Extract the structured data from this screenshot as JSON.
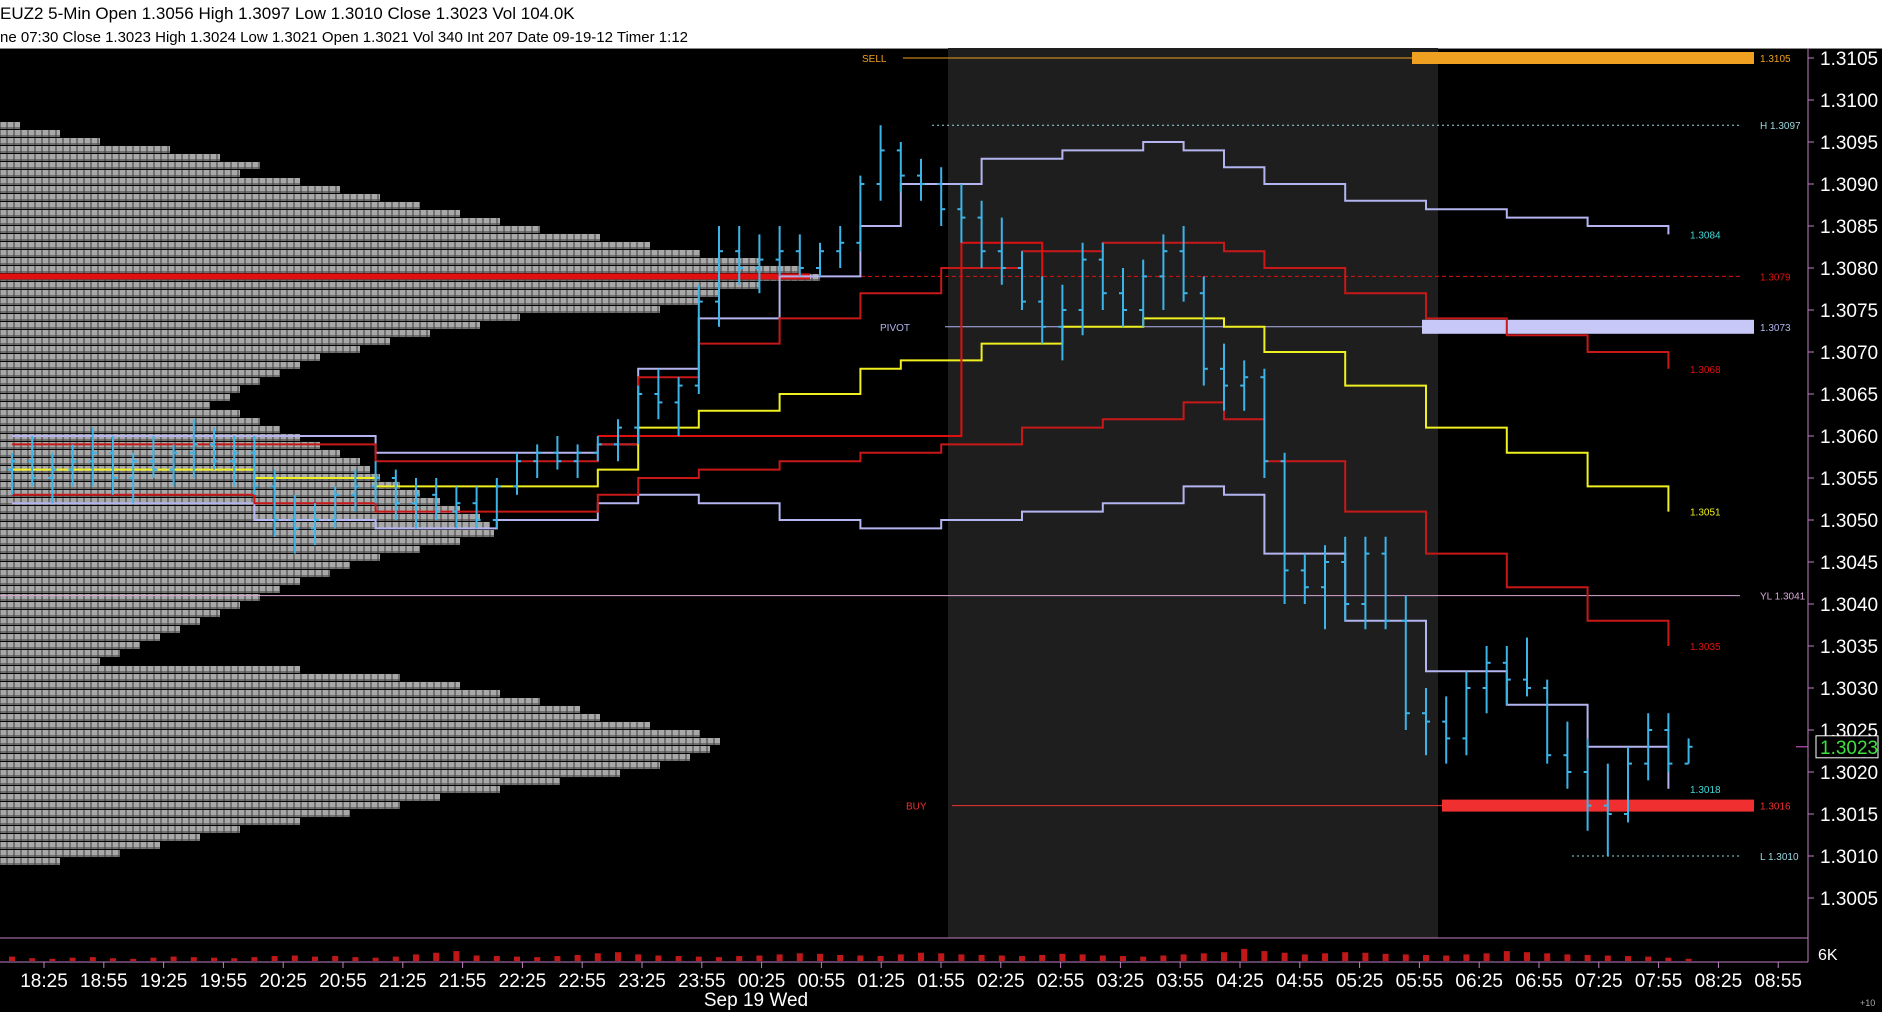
{
  "header": {
    "symbol_line": "EUZ2 5-Min Open 1.3056 High 1.3097 Low 1.3010 Close 1.3023 Vol 104.0K",
    "bar_line": "ne 07:30   Close 1.3023   High 1.3024   Low 1.3021   Open 1.3021   Vol 340   Int 207   Date 09-19-12   Timer 1:12"
  },
  "colors": {
    "background": "#000000",
    "session_shade": "#1e1e1e",
    "profile_gray": "#a8a8a8",
    "poc_red": "#e01010",
    "price_bars": "#3cb4e8",
    "vwap_yellow": "#f0f020",
    "band_red": "#c81818",
    "band_lavender": "#b4b4f0",
    "sell_orange": "#f0a020",
    "buy_red": "#f03030"
  },
  "chart_data": {
    "type": "line",
    "title": "EUZ2 5-Min",
    "ylim": [
      1.3002,
      1.3108
    ],
    "yticks": [
      "1.3105",
      "1.3100",
      "1.3095",
      "1.3090",
      "1.3085",
      "1.3080",
      "1.3075",
      "1.3070",
      "1.3065",
      "1.3060",
      "1.3055",
      "1.3050",
      "1.3045",
      "1.3040",
      "1.3035",
      "1.3030",
      "1.3025",
      "1.3020",
      "1.3015",
      "1.3010",
      "1.3005"
    ],
    "xticks": [
      "18:25",
      "18:55",
      "19:25",
      "19:55",
      "20:25",
      "20:55",
      "21:25",
      "21:55",
      "22:25",
      "22:55",
      "23:25",
      "23:55",
      "00:25",
      "00:55",
      "01:25",
      "01:55",
      "02:25",
      "02:55",
      "03:25",
      "03:55",
      "04:25",
      "04:55",
      "05:25",
      "05:55",
      "06:25",
      "06:55",
      "07:25",
      "07:55",
      "08:25",
      "08:55"
    ],
    "date_label": "Sep 19 Wed",
    "last_price_label": "1.3023",
    "volume_scale_label": "6K",
    "corner_label": "+10",
    "levels": [
      {
        "tag": "SELL",
        "value": 1.3105,
        "label": "1.3105",
        "color": "#f0a020"
      },
      {
        "tag": "H",
        "value": 1.3097,
        "label": "H 1.3097",
        "color": "#9ad8e0"
      },
      {
        "tag": "R",
        "value": 1.3079,
        "label": "1.3079",
        "color": "#e01010"
      },
      {
        "tag": "PIVOT",
        "value": 1.3073,
        "label": "1.3073",
        "color": "#b4b4f0"
      },
      {
        "tag": "YL",
        "value": 1.3041,
        "label": "YL 1.3041",
        "color": "#d8a8d8"
      },
      {
        "tag": "BUY",
        "value": 1.3016,
        "label": "1.3016",
        "color": "#f03030"
      },
      {
        "tag": "L",
        "value": 1.301,
        "label": "L 1.3010",
        "color": "#9ad8e0"
      }
    ],
    "band_labels": [
      {
        "value": 1.3084,
        "label": "1.3084",
        "color": "#40d8d8"
      },
      {
        "value": 1.3068,
        "label": "1.3068",
        "color": "#e01010"
      },
      {
        "value": 1.3051,
        "label": "1.3051",
        "color": "#f0f020"
      },
      {
        "value": 1.3035,
        "label": "1.3035",
        "color": "#e01010"
      },
      {
        "value": 1.3018,
        "label": "1.3018",
        "color": "#40d8d8"
      }
    ],
    "price_bars_series": [
      [
        0,
        1.3056,
        1.3058,
        1.3053,
        1.3057
      ],
      [
        1,
        1.3057,
        1.306,
        1.3054,
        1.3055
      ],
      [
        2,
        1.3055,
        1.3058,
        1.3052,
        1.3056
      ],
      [
        3,
        1.3056,
        1.3059,
        1.3054,
        1.3057
      ],
      [
        4,
        1.3057,
        1.3061,
        1.3054,
        1.3058
      ],
      [
        5,
        1.3058,
        1.306,
        1.3053,
        1.3055
      ],
      [
        6,
        1.3055,
        1.3058,
        1.3052,
        1.3057
      ],
      [
        7,
        1.3057,
        1.306,
        1.3055,
        1.3056
      ],
      [
        8,
        1.3056,
        1.3059,
        1.3054,
        1.3058
      ],
      [
        9,
        1.3058,
        1.3062,
        1.3055,
        1.3059
      ],
      [
        10,
        1.3059,
        1.3061,
        1.3056,
        1.3057
      ],
      [
        11,
        1.3057,
        1.306,
        1.3054,
        1.3058
      ],
      [
        12,
        1.3058,
        1.306,
        1.3053,
        1.3054
      ],
      [
        13,
        1.3054,
        1.3056,
        1.3048,
        1.305
      ],
      [
        14,
        1.305,
        1.3053,
        1.3046,
        1.3049
      ],
      [
        15,
        1.3049,
        1.3052,
        1.3047,
        1.305
      ],
      [
        16,
        1.305,
        1.3054,
        1.3049,
        1.3053
      ],
      [
        17,
        1.3053,
        1.3056,
        1.3051,
        1.3054
      ],
      [
        18,
        1.3054,
        1.3057,
        1.3052,
        1.3055
      ],
      [
        19,
        1.3055,
        1.3056,
        1.305,
        1.3052
      ],
      [
        20,
        1.3052,
        1.3055,
        1.3049,
        1.3053
      ],
      [
        21,
        1.3053,
        1.3055,
        1.305,
        1.3051
      ],
      [
        22,
        1.3051,
        1.3054,
        1.3049,
        1.3052
      ],
      [
        23,
        1.3052,
        1.3054,
        1.3049,
        1.305
      ],
      [
        24,
        1.305,
        1.3055,
        1.3049,
        1.3054
      ],
      [
        25,
        1.3054,
        1.3058,
        1.3053,
        1.3057
      ],
      [
        26,
        1.3057,
        1.3059,
        1.3055,
        1.3058
      ],
      [
        27,
        1.3058,
        1.306,
        1.3056,
        1.3057
      ],
      [
        28,
        1.3057,
        1.3059,
        1.3055,
        1.3058
      ],
      [
        29,
        1.3058,
        1.306,
        1.3057,
        1.3059
      ],
      [
        30,
        1.3059,
        1.3062,
        1.3057,
        1.3061
      ],
      [
        31,
        1.3061,
        1.3066,
        1.3059,
        1.3065
      ],
      [
        32,
        1.3065,
        1.3068,
        1.3062,
        1.3064
      ],
      [
        33,
        1.3064,
        1.3067,
        1.306,
        1.3066
      ],
      [
        34,
        1.3066,
        1.3078,
        1.3065,
        1.3076
      ],
      [
        35,
        1.3076,
        1.3085,
        1.3073,
        1.3082
      ],
      [
        36,
        1.3082,
        1.3085,
        1.3078,
        1.308
      ],
      [
        37,
        1.308,
        1.3084,
        1.3077,
        1.3081
      ],
      [
        38,
        1.3081,
        1.3085,
        1.3079,
        1.3082
      ],
      [
        39,
        1.3082,
        1.3084,
        1.3079,
        1.308
      ],
      [
        40,
        1.308,
        1.3083,
        1.3079,
        1.3082
      ],
      [
        41,
        1.3082,
        1.3085,
        1.308,
        1.3083
      ],
      [
        42,
        1.3083,
        1.3091,
        1.3082,
        1.309
      ],
      [
        43,
        1.309,
        1.3097,
        1.3088,
        1.3094
      ],
      [
        44,
        1.3094,
        1.3095,
        1.3089,
        1.3091
      ],
      [
        45,
        1.3091,
        1.3093,
        1.3088,
        1.309
      ],
      [
        46,
        1.309,
        1.3092,
        1.3085,
        1.3087
      ],
      [
        47,
        1.3087,
        1.309,
        1.3083,
        1.3086
      ],
      [
        48,
        1.3086,
        1.3088,
        1.308,
        1.3082
      ],
      [
        49,
        1.3082,
        1.3086,
        1.3078,
        1.308
      ],
      [
        50,
        1.308,
        1.3082,
        1.3075,
        1.3076
      ],
      [
        51,
        1.3076,
        1.3079,
        1.3071,
        1.3073
      ],
      [
        52,
        1.3073,
        1.3078,
        1.3069,
        1.3075
      ],
      [
        53,
        1.3075,
        1.3083,
        1.3072,
        1.3081
      ],
      [
        54,
        1.3081,
        1.3083,
        1.3075,
        1.3077
      ],
      [
        55,
        1.3077,
        1.308,
        1.3073,
        1.3075
      ],
      [
        56,
        1.3075,
        1.3081,
        1.3073,
        1.3079
      ],
      [
        57,
        1.3079,
        1.3084,
        1.3075,
        1.3082
      ],
      [
        58,
        1.3082,
        1.3085,
        1.3076,
        1.3077
      ],
      [
        59,
        1.3077,
        1.3079,
        1.3066,
        1.3068
      ],
      [
        60,
        1.3068,
        1.3071,
        1.3063,
        1.3066
      ],
      [
        61,
        1.3066,
        1.3069,
        1.3063,
        1.3067
      ],
      [
        62,
        1.3067,
        1.3068,
        1.3055,
        1.3057
      ],
      [
        63,
        1.3057,
        1.3058,
        1.304,
        1.3044
      ],
      [
        64,
        1.3044,
        1.3046,
        1.304,
        1.3042
      ],
      [
        65,
        1.3042,
        1.3047,
        1.3037,
        1.3045
      ],
      [
        66,
        1.3045,
        1.3048,
        1.3038,
        1.304
      ],
      [
        67,
        1.304,
        1.3048,
        1.3037,
        1.3046
      ],
      [
        68,
        1.3046,
        1.3048,
        1.3037,
        1.3038
      ],
      [
        69,
        1.3038,
        1.3041,
        1.3025,
        1.3027
      ],
      [
        70,
        1.3027,
        1.303,
        1.3022,
        1.3026
      ],
      [
        71,
        1.3026,
        1.3029,
        1.3021,
        1.3024
      ],
      [
        72,
        1.3024,
        1.3032,
        1.3022,
        1.303
      ],
      [
        73,
        1.303,
        1.3035,
        1.3027,
        1.3033
      ],
      [
        74,
        1.3033,
        1.3035,
        1.3028,
        1.3031
      ],
      [
        75,
        1.3031,
        1.3036,
        1.3029,
        1.303
      ],
      [
        76,
        1.303,
        1.3031,
        1.3021,
        1.3022
      ],
      [
        77,
        1.3022,
        1.3026,
        1.3018,
        1.302
      ],
      [
        78,
        1.302,
        1.3024,
        1.3013,
        1.3016
      ],
      [
        79,
        1.3016,
        1.3021,
        1.301,
        1.3015
      ],
      [
        80,
        1.3015,
        1.3023,
        1.3014,
        1.3021
      ],
      [
        81,
        1.3021,
        1.3027,
        1.3019,
        1.3025
      ],
      [
        82,
        1.3025,
        1.3027,
        1.302,
        1.3021
      ],
      [
        83,
        1.3021,
        1.3024,
        1.3021,
        1.3023
      ]
    ],
    "vwap_series": [
      [
        0,
        1.3056
      ],
      [
        6,
        1.3056
      ],
      [
        12,
        1.3055
      ],
      [
        18,
        1.3054
      ],
      [
        24,
        1.3054
      ],
      [
        29,
        1.3056
      ],
      [
        31,
        1.3061
      ],
      [
        34,
        1.3063
      ],
      [
        38,
        1.3065
      ],
      [
        42,
        1.3068
      ],
      [
        44,
        1.3069
      ],
      [
        48,
        1.3071
      ],
      [
        52,
        1.3073
      ],
      [
        56,
        1.3074
      ],
      [
        58,
        1.3074
      ],
      [
        60,
        1.3073
      ],
      [
        62,
        1.307
      ],
      [
        66,
        1.3066
      ],
      [
        70,
        1.3061
      ],
      [
        74,
        1.3058
      ],
      [
        78,
        1.3054
      ],
      [
        82,
        1.3051
      ]
    ],
    "upper_red_series": [
      [
        0,
        1.3059
      ],
      [
        12,
        1.3059
      ],
      [
        18,
        1.3057
      ],
      [
        24,
        1.3057
      ],
      [
        29,
        1.3059
      ],
      [
        31,
        1.3067
      ],
      [
        34,
        1.3071
      ],
      [
        38,
        1.3074
      ],
      [
        42,
        1.3077
      ],
      [
        46,
        1.308
      ],
      [
        50,
        1.3082
      ],
      [
        54,
        1.3083
      ],
      [
        58,
        1.3083
      ],
      [
        60,
        1.3082
      ],
      [
        62,
        1.308
      ],
      [
        66,
        1.3077
      ],
      [
        70,
        1.3074
      ],
      [
        74,
        1.3072
      ],
      [
        78,
        1.307
      ],
      [
        82,
        1.3068
      ]
    ],
    "lower_red_series": [
      [
        0,
        1.3053
      ],
      [
        12,
        1.3052
      ],
      [
        18,
        1.3051
      ],
      [
        24,
        1.3051
      ],
      [
        29,
        1.3053
      ],
      [
        31,
        1.3055
      ],
      [
        34,
        1.3056
      ],
      [
        38,
        1.3057
      ],
      [
        42,
        1.3058
      ],
      [
        46,
        1.3059
      ],
      [
        50,
        1.3061
      ],
      [
        54,
        1.3062
      ],
      [
        58,
        1.3064
      ],
      [
        60,
        1.3062
      ],
      [
        62,
        1.3057
      ],
      [
        66,
        1.3051
      ],
      [
        70,
        1.3046
      ],
      [
        74,
        1.3042
      ],
      [
        78,
        1.3038
      ],
      [
        82,
        1.3035
      ]
    ],
    "upper_lavender_series": [
      [
        0,
        1.306
      ],
      [
        12,
        1.306
      ],
      [
        18,
        1.3058
      ],
      [
        24,
        1.3058
      ],
      [
        29,
        1.3059
      ],
      [
        31,
        1.3068
      ],
      [
        34,
        1.3074
      ],
      [
        38,
        1.3079
      ],
      [
        42,
        1.3085
      ],
      [
        44,
        1.309
      ],
      [
        48,
        1.3093
      ],
      [
        52,
        1.3094
      ],
      [
        56,
        1.3095
      ],
      [
        58,
        1.3094
      ],
      [
        60,
        1.3092
      ],
      [
        62,
        1.309
      ],
      [
        66,
        1.3088
      ],
      [
        70,
        1.3087
      ],
      [
        74,
        1.3086
      ],
      [
        78,
        1.3085
      ],
      [
        82,
        1.3084
      ]
    ],
    "lower_lavender_series": [
      [
        0,
        1.3052
      ],
      [
        12,
        1.305
      ],
      [
        18,
        1.3049
      ],
      [
        24,
        1.305
      ],
      [
        29,
        1.3052
      ],
      [
        31,
        1.3053
      ],
      [
        34,
        1.3052
      ],
      [
        38,
        1.305
      ],
      [
        42,
        1.3049
      ],
      [
        46,
        1.305
      ],
      [
        50,
        1.3051
      ],
      [
        54,
        1.3052
      ],
      [
        58,
        1.3054
      ],
      [
        60,
        1.3053
      ],
      [
        62,
        1.3046
      ],
      [
        66,
        1.3038
      ],
      [
        70,
        1.3032
      ],
      [
        74,
        1.3028
      ],
      [
        78,
        1.3023
      ],
      [
        82,
        1.3018
      ]
    ],
    "pivot_step_series": [
      [
        29,
        1.306
      ],
      [
        47,
        1.306
      ],
      [
        47,
        1.3083
      ],
      [
        51,
        1.3083
      ],
      [
        51,
        1.3079
      ]
    ],
    "volume_series": [
      8,
      5,
      4,
      6,
      7,
      5,
      4,
      6,
      8,
      7,
      6,
      5,
      7,
      9,
      10,
      8,
      9,
      7,
      6,
      8,
      12,
      15,
      18,
      10,
      9,
      8,
      7,
      9,
      11,
      14,
      16,
      12,
      10,
      9,
      8,
      7,
      9,
      10,
      12,
      14,
      13,
      11,
      10,
      9,
      12,
      15,
      14,
      12,
      11,
      10,
      9,
      11,
      13,
      12,
      10,
      9,
      8,
      10,
      12,
      14,
      16,
      22,
      18,
      15,
      12,
      14,
      16,
      15,
      13,
      12,
      11,
      10,
      12,
      14,
      18,
      16,
      14,
      12,
      11,
      10,
      9,
      8,
      6,
      4
    ]
  }
}
